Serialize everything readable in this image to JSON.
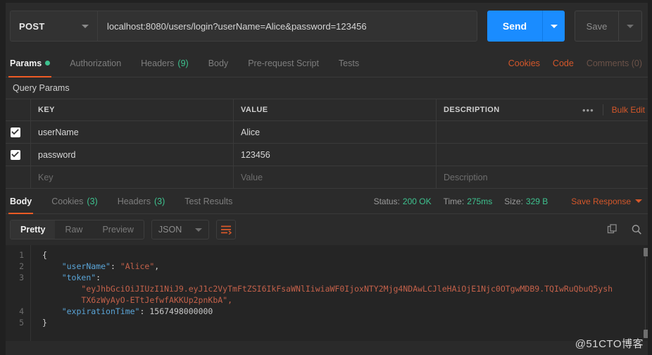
{
  "request": {
    "method": "POST",
    "url": "localhost:8080/users/login?userName=Alice&password=123456",
    "send_label": "Send",
    "save_label": "Save"
  },
  "request_tabs": [
    {
      "label": "Params",
      "badge": "",
      "active": true,
      "dot": true
    },
    {
      "label": "Authorization",
      "badge": "",
      "active": false,
      "dot": false
    },
    {
      "label": "Headers",
      "badge": "(9)",
      "active": false,
      "dot": false
    },
    {
      "label": "Body",
      "badge": "",
      "active": false,
      "dot": false
    },
    {
      "label": "Pre-request Script",
      "badge": "",
      "active": false,
      "dot": false
    },
    {
      "label": "Tests",
      "badge": "",
      "active": false,
      "dot": false
    }
  ],
  "request_links": [
    {
      "label": "Cookies",
      "dim": false
    },
    {
      "label": "Code",
      "dim": false
    },
    {
      "label": "Comments (0)",
      "dim": true
    }
  ],
  "params": {
    "section_title": "Query Params",
    "columns": {
      "key": "KEY",
      "value": "VALUE",
      "description": "DESCRIPTION"
    },
    "bulk_edit_label": "Bulk Edit",
    "ellipsis_label": "•••",
    "rows": [
      {
        "checked": true,
        "key": "userName",
        "value": "Alice",
        "description": ""
      },
      {
        "checked": true,
        "key": "password",
        "value": "123456",
        "description": ""
      }
    ],
    "placeholder_row": {
      "key": "Key",
      "value": "Value",
      "description": "Description"
    }
  },
  "response_tabs": [
    {
      "label": "Body",
      "badge": "",
      "active": true
    },
    {
      "label": "Cookies",
      "badge": "(3)",
      "active": false
    },
    {
      "label": "Headers",
      "badge": "(3)",
      "active": false
    },
    {
      "label": "Test Results",
      "badge": "",
      "active": false
    }
  ],
  "response_meta": {
    "status_label": "Status:",
    "status_value": "200 OK",
    "time_label": "Time:",
    "time_value": "275ms",
    "size_label": "Size:",
    "size_value": "329 B",
    "save_response_label": "Save Response"
  },
  "viewer": {
    "modes": [
      {
        "label": "Pretty",
        "active": true
      },
      {
        "label": "Raw",
        "active": false
      },
      {
        "label": "Preview",
        "active": false
      }
    ],
    "format": "JSON",
    "wrap_icon": "word-wrap-icon",
    "copy_icon": "copy-icon",
    "search_icon": "search-icon"
  },
  "response_body": {
    "line_numbers": [
      "1",
      "2",
      "3",
      "4",
      "5"
    ],
    "userName_key": "\"userName\"",
    "userName_value": "\"Alice\"",
    "token_key": "\"token\"",
    "token_value_line1": "\"eyJhbGciOiJIUzI1NiJ9.eyJ1c2VyTmFtZSI6IkFsaWNlIiwiaWF0IjoxNTY2Mjg4NDAwLCJleHAiOjE1Njc0OTgwMDB9.TQIwRuQbuQ5ysh",
    "token_value_line2": "TX6zWyAyO-ETtJefwfAKKUp2pnKbA\",",
    "expiration_key": "\"expirationTime\"",
    "expiration_value": "1567498000000",
    "open_brace": "{",
    "close_brace": "}"
  },
  "watermark": "@51CTO博客",
  "colors": {
    "accent_orange": "#ef5b25",
    "link_orange": "#d4572a",
    "send_blue": "#1a8cff",
    "green": "#3ec28f",
    "bg": "#2b2b2b"
  }
}
